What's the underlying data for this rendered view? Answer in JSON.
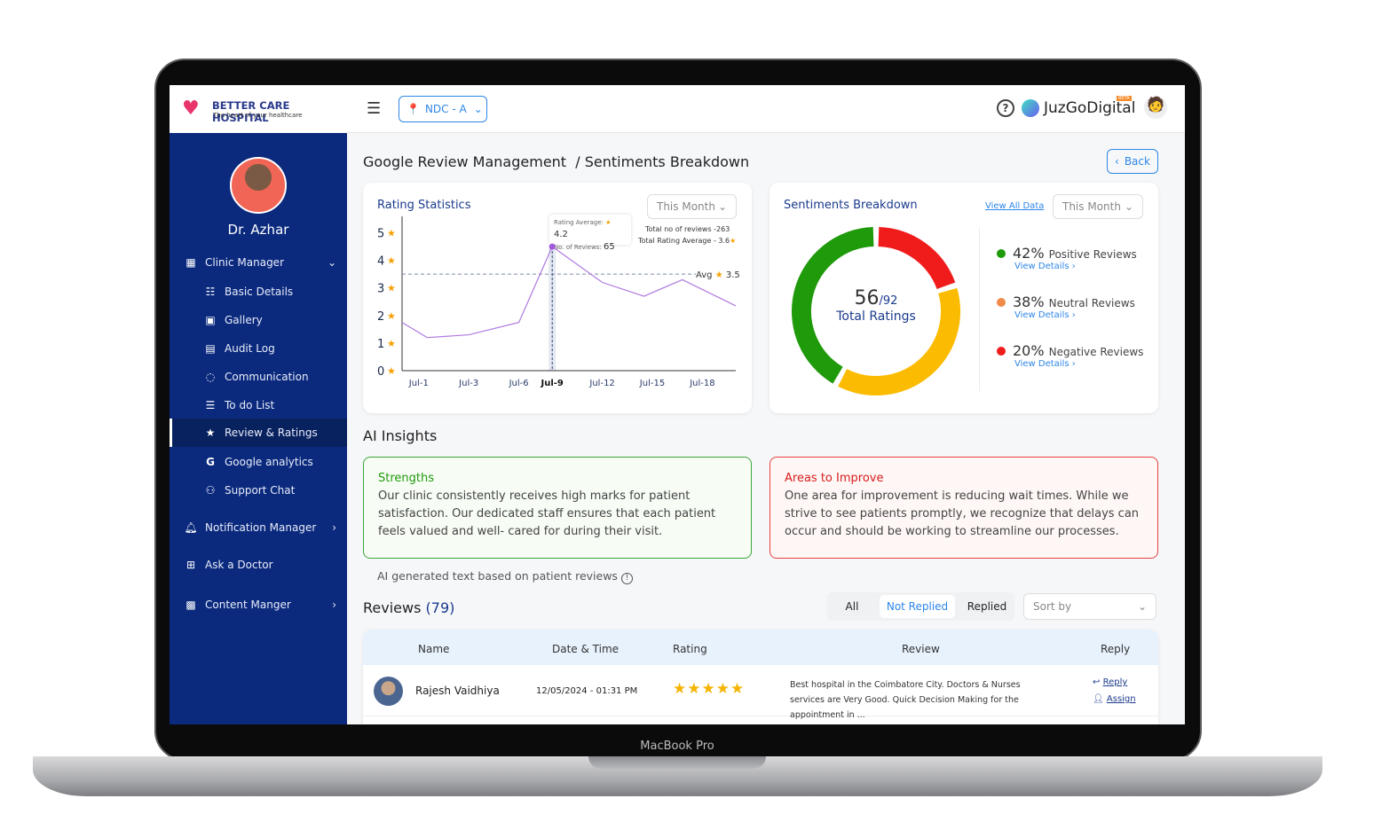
{
  "device": {
    "label": "MacBook Pro"
  },
  "brand": {
    "name": "BETTER CARE HOSPITAL",
    "tagline": "The heart of your healthcare"
  },
  "header": {
    "location": "NDC - A",
    "partner": "JuzGoDigital",
    "partner_badge": "BETA"
  },
  "user": {
    "name": "Dr. Azhar"
  },
  "sidebar": {
    "items": [
      {
        "label": "Clinic Manager",
        "icon": "building-icon",
        "expanded": true
      },
      {
        "label": "Basic Details",
        "icon": "id-card-icon"
      },
      {
        "label": "Gallery",
        "icon": "image-icon"
      },
      {
        "label": "Audit Log",
        "icon": "audit-icon"
      },
      {
        "label": "Communication",
        "icon": "chat-icon"
      },
      {
        "label": "To do List",
        "icon": "list-icon"
      },
      {
        "label": "Review & Ratings",
        "icon": "star-message-icon",
        "active": true
      },
      {
        "label": "Google analytics",
        "icon": "google-icon"
      },
      {
        "label": "Support Chat",
        "icon": "support-icon"
      },
      {
        "label": "Notification Manager",
        "icon": "bell-icon"
      },
      {
        "label": "Ask a Doctor",
        "icon": "plus-box-icon"
      },
      {
        "label": "Content Manger",
        "icon": "images-icon"
      }
    ]
  },
  "page": {
    "breadcrumb": "Google Review Management  / Sentiments Breakdown",
    "back": "Back"
  },
  "rating": {
    "title": "Rating Statistics",
    "period": "This Month",
    "tooltip_avg_label": "Rating Average:",
    "tooltip_avg": "4.2",
    "tooltip_count_label": "No. of Reviews:",
    "tooltip_count": "65",
    "total_reviews": "Total no of reviews -263",
    "total_avg": "Total Rating Average - 3.6",
    "avg_label": "Avg",
    "avg_value": "3.5"
  },
  "chart_data": {
    "type": "line",
    "x": [
      0,
      1.5,
      4,
      7,
      9,
      12,
      14.5,
      16.8,
      20
    ],
    "y": [
      1.75,
      1.2,
      1.3,
      1.75,
      4.5,
      3.2,
      2.7,
      3.3,
      2.35
    ],
    "xticks": [
      1,
      4,
      7,
      9,
      12,
      15,
      18
    ],
    "xticklabels": [
      "Jul-1",
      "Jul-3",
      "Jul-6",
      "Jul-9",
      "Jul-12",
      "Jul-15",
      "Jul-18"
    ],
    "highlight": "Jul-9",
    "yticks": [
      0,
      1,
      2,
      3,
      4,
      5
    ],
    "ylim": [
      0,
      5.5
    ],
    "xlim": [
      0,
      20
    ],
    "avg_line": 3.5,
    "color": "#b07ae0"
  },
  "sentiment": {
    "title": "Sentiments Breakdown",
    "view_all": "View All Data",
    "period": "This Month",
    "count": "56",
    "total": "/92",
    "total_label": "Total Ratings",
    "items": [
      {
        "pct": "42%",
        "label": "Positive Reviews",
        "value": 42,
        "color": "#1f9a0a",
        "details": "View Details ›"
      },
      {
        "pct": "38%",
        "label": "Neutral Reviews",
        "value": 38,
        "color": "#fbbb00",
        "dot": "#ef8a4a",
        "details": "View Details ›"
      },
      {
        "pct": "20%",
        "label": "Negative Reviews",
        "value": 20,
        "color": "#f01c1c",
        "details": "View Details ›"
      }
    ]
  },
  "insights": {
    "title": "AI Insights",
    "strengths_title": "Strengths",
    "strengths": "Our clinic consistently receives high marks for patient satisfaction. Our dedicated staff ensures that each patient feels valued and well- cared for during their visit.",
    "improve_title": "Areas to Improve",
    "improve": "One area for improvement is reducing wait times. While we strive to see patients promptly, we recognize that delays can occur and should be working to streamline our processes.",
    "note": "AI generated text based on patient reviews"
  },
  "reviews": {
    "title": "Reviews",
    "count": "(79)",
    "filters": [
      "All",
      "Not Replied",
      "Replied"
    ],
    "active_filter": "Not Replied",
    "sort": "Sort by",
    "columns": [
      "Name",
      "Date & Time",
      "Rating",
      "Review",
      "Reply"
    ],
    "rows": [
      {
        "name": "Rajesh Vaidhiya",
        "date": "12/05/2024 - 01:31 PM",
        "stars": 5,
        "review": "Best hospital in the Coimbatore City. Doctors & Nurses services are Very Good. Quick Decision Making for the appointment in ...",
        "reply": "Reply",
        "assign": "Assign"
      }
    ]
  }
}
